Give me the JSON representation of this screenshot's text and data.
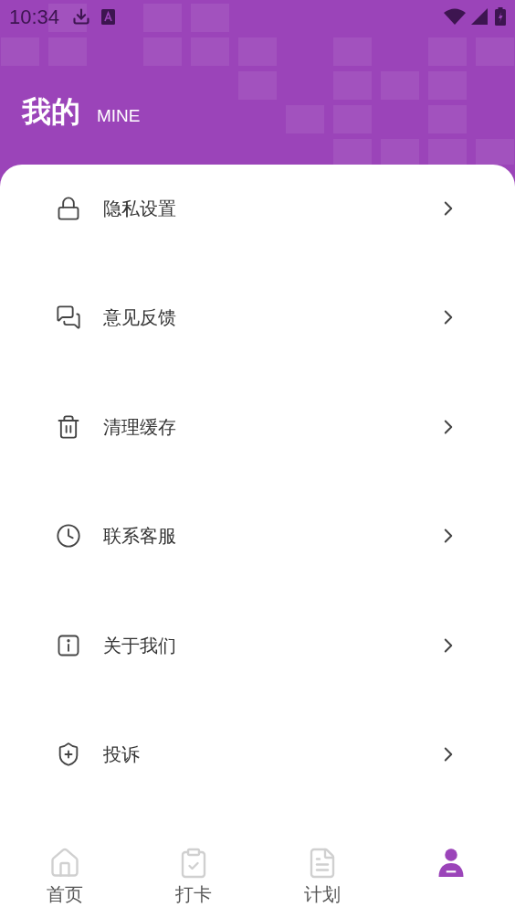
{
  "status_bar": {
    "time": "10:34"
  },
  "header": {
    "title": "我的",
    "subtitle": "MINE"
  },
  "menu": [
    {
      "kind": "lock",
      "label": "隐私设置"
    },
    {
      "kind": "chat",
      "label": "意见反馈"
    },
    {
      "kind": "trash",
      "label": "清理缓存"
    },
    {
      "kind": "clock",
      "label": "联系客服"
    },
    {
      "kind": "info",
      "label": "关于我们"
    },
    {
      "kind": "shield",
      "label": "投诉"
    }
  ],
  "bottom_nav": [
    {
      "kind": "home",
      "label": "首页",
      "selected": false
    },
    {
      "kind": "checkin",
      "label": "打卡",
      "selected": false
    },
    {
      "kind": "plan",
      "label": "计划",
      "selected": false
    },
    {
      "kind": "mine",
      "selected": true
    }
  ]
}
